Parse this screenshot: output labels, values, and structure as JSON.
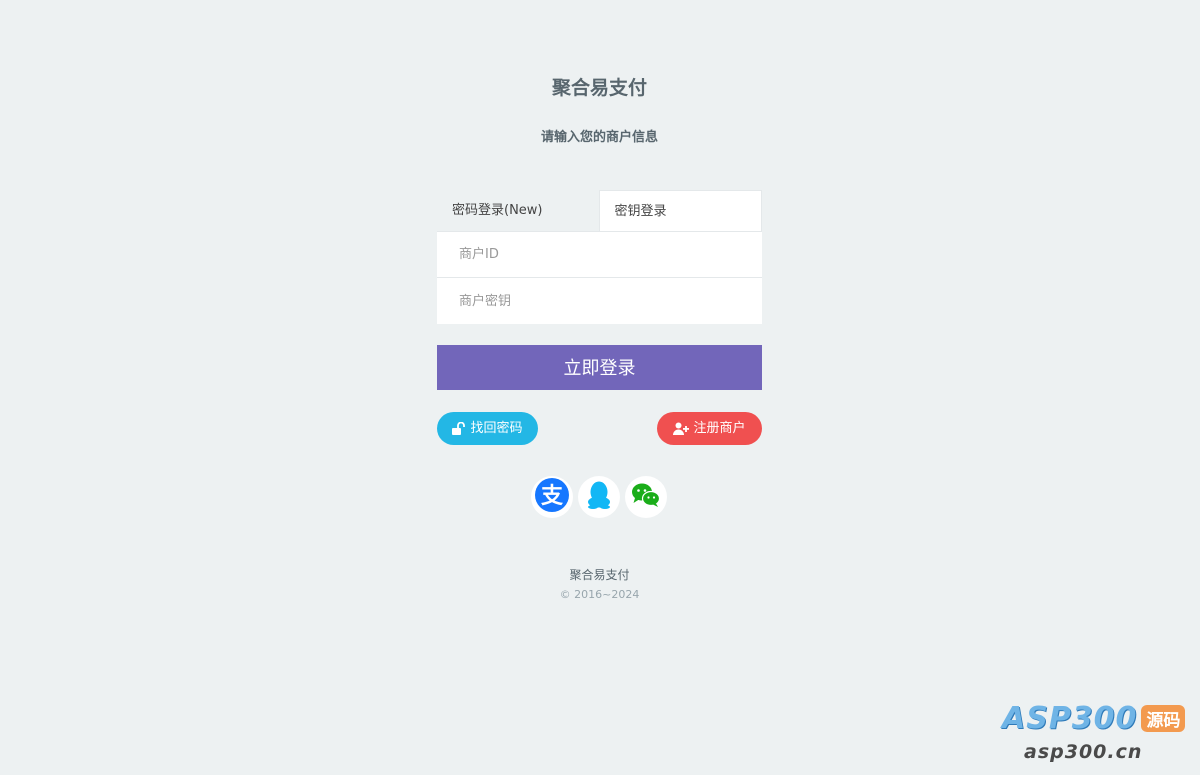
{
  "header": {
    "brand": "聚合易支付",
    "subtitle": "请输入您的商户信息"
  },
  "tabs": [
    {
      "label": "密码登录(New)",
      "active": false
    },
    {
      "label": "密钥登录",
      "active": true
    }
  ],
  "form": {
    "merchant_id_placeholder": "商户ID",
    "merchant_key_placeholder": "商户密钥",
    "login_button": "立即登录"
  },
  "links": {
    "find_password": "找回密码",
    "register": "注册商户"
  },
  "social": [
    {
      "icon": "alipay-icon",
      "color": "#1677ff"
    },
    {
      "icon": "qq-icon",
      "color": "#12b7f5"
    },
    {
      "icon": "wechat-icon",
      "color": "#1aad19"
    }
  ],
  "footer": {
    "name": "聚合易支付",
    "copyright": "© 2016~2024"
  },
  "watermark": {
    "brand": "ASP300",
    "badge": "源码",
    "url": "asp300.cn"
  },
  "colors": {
    "background": "#edf1f2",
    "primary": "#7266ba",
    "info": "#23b7e5",
    "danger": "#f05050"
  }
}
